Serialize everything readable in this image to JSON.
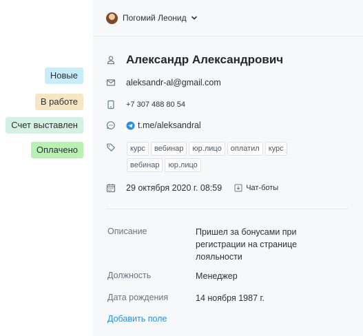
{
  "statuses": [
    "Новые",
    "В работе",
    "Счет выставлен",
    "Оплачено"
  ],
  "header": {
    "user_name": "Погомий Леонид"
  },
  "contact": {
    "name": "Александр Александрович",
    "email": "aleksandr-al@gmail.com",
    "phone": "+7 307 488 80 54",
    "telegram": "t.me/aleksandral",
    "tags": [
      "курс",
      "вебинар",
      "юр.лицо",
      "оплатил",
      "курс",
      "вебинар",
      "юр.лицо"
    ],
    "created": "29 октября 2020 г. 08:59",
    "source": "Чат-боты"
  },
  "fields": [
    {
      "label": "Описание",
      "value": "Пришел за бонусами при регистрации на странице лояльности"
    },
    {
      "label": "Должность",
      "value": "Менеджер"
    },
    {
      "label": "Дата рождения",
      "value": "14 ноября 1987 г."
    }
  ],
  "add_field_label": "Добавить поле",
  "colors": {
    "accent": "#2d8fd5",
    "new": "#c9edf8",
    "in_work": "#f6e6c4",
    "invoice": "#d5f1e4",
    "paid": "#b9f1b2"
  }
}
